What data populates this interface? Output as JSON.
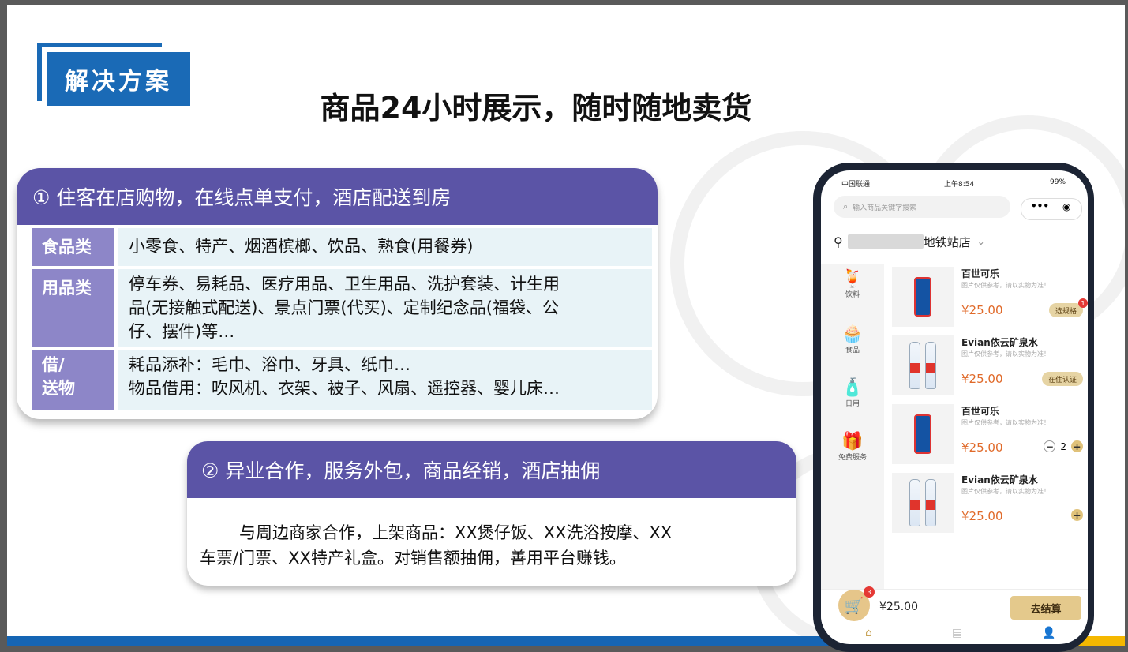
{
  "tag": "解决方案",
  "title": "商品24小时展示，随时随地卖货",
  "section1": {
    "heading": "① 住客在店购物，在线点单支付，酒店配送到房",
    "rows": [
      {
        "category": "食品类",
        "lines": [
          "小零食、特产、烟酒槟榔、饮品、熟食(用餐券)"
        ]
      },
      {
        "category": "用品类",
        "lines": [
          "停车券、易耗品、医疗用品、卫生用品、洗护套装、计生用",
          "品(无接触式配送)、景点门票(代买)、定制纪念品(福袋、公",
          "仔、摆件)等…"
        ]
      },
      {
        "category": "借/送物",
        "lines": [
          "耗品添补：毛巾、浴巾、牙具、纸巾…",
          "物品借用：吹风机、衣架、被子、风扇、遥控器、婴儿床…"
        ]
      }
    ]
  },
  "section2": {
    "heading": "② 异业合作，服务外包，商品经销，酒店抽佣",
    "line1": "与周边商家合作，上架商品：XX煲仔饭、XX洗浴按摩、XX",
    "line2": "车票/门票、XX特产礼盒。对销售额抽佣，善用平台赚钱。"
  },
  "phone": {
    "carrier": "中国联通",
    "time": "上午8:54",
    "battery": "99%",
    "search_placeholder": "输入商品关键字搜索",
    "store_name": "地铁站店",
    "nav": [
      {
        "label": "饮料",
        "icon": "drink-icon"
      },
      {
        "label": "食品",
        "icon": "cake-icon"
      },
      {
        "label": "日用",
        "icon": "bottle-icon"
      },
      {
        "label": "免费服务",
        "icon": "gift-icon"
      }
    ],
    "products": [
      {
        "name": "百世可乐",
        "sub": "图片仅供参考，请以实物为准！",
        "price": "¥25.00",
        "action": "选规格",
        "badge": "1"
      },
      {
        "name": "Evian依云矿泉水",
        "sub": "图片仅供参考，请以实物为准！",
        "price": "¥25.00",
        "action": "在住认证"
      },
      {
        "name": "百世可乐",
        "sub": "图片仅供参考，请以实物为准！",
        "price": "¥25.00",
        "qty": "2"
      },
      {
        "name": "Evian依云矿泉水",
        "sub": "图片仅供参考，请以实物为准！",
        "price": "¥25.00"
      }
    ],
    "cart_count": "3",
    "cart_total": "¥25.00",
    "checkout_label": "去结算",
    "brand_colors": {
      "purple": "#5b54a6",
      "blue": "#1a6ab6",
      "gold": "#e4c98c"
    }
  }
}
